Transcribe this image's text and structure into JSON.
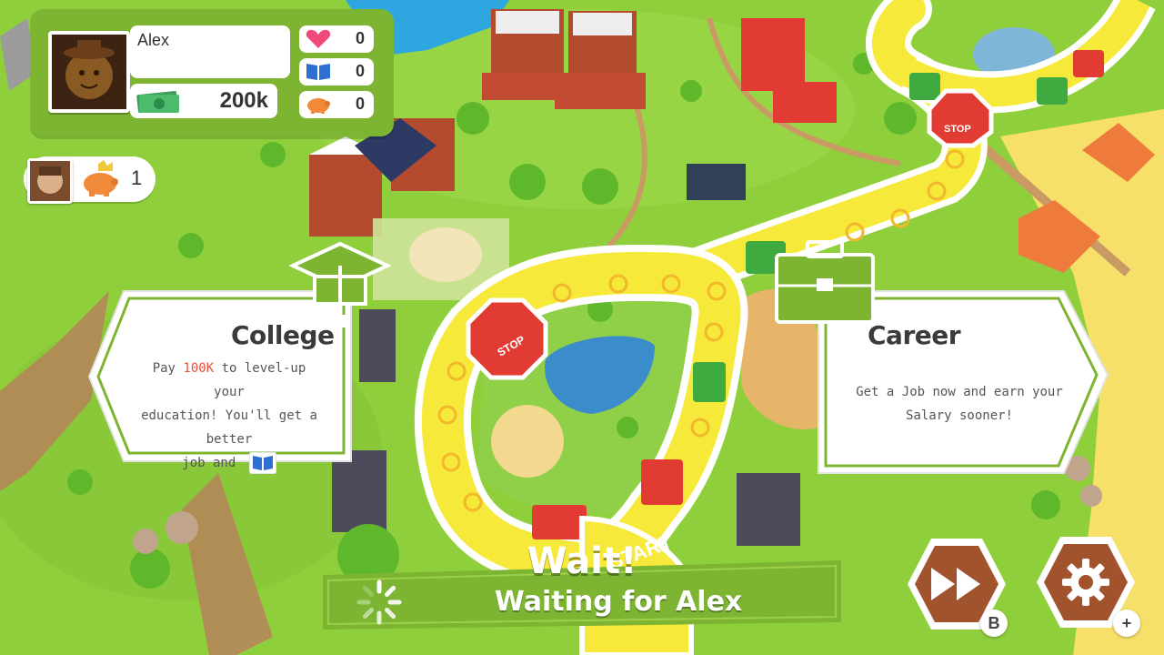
{
  "player": {
    "name": "Alex",
    "money": "200k",
    "hearts": "0",
    "books": "0",
    "pigs": "0"
  },
  "opponent": {
    "pig_count": "1"
  },
  "choices": {
    "college": {
      "title": "College",
      "body_pre": "Pay ",
      "body_highlight": "100K",
      "body_post_line1": " to level-up your",
      "body_line2": "education! You'll get a better",
      "body_line3": "job and"
    },
    "career": {
      "title": "Career",
      "body_line1": "Get a Job now and earn your",
      "body_line2": "Salary sooner!"
    }
  },
  "status": {
    "title": "Wait!",
    "subtitle": "Waiting for Alex"
  },
  "buttons": {
    "fast_forward_hint": "B",
    "settings_hint": "+"
  },
  "board_labels": {
    "stop": "STOP",
    "start": "START"
  },
  "colors": {
    "grass": "#8fcf3c",
    "panel_green": "#7db532",
    "dark_green": "#6aa72c",
    "highlight_red": "#e8503a",
    "path_yellow": "#f7e93a",
    "hex_brown": "#a1532e"
  }
}
